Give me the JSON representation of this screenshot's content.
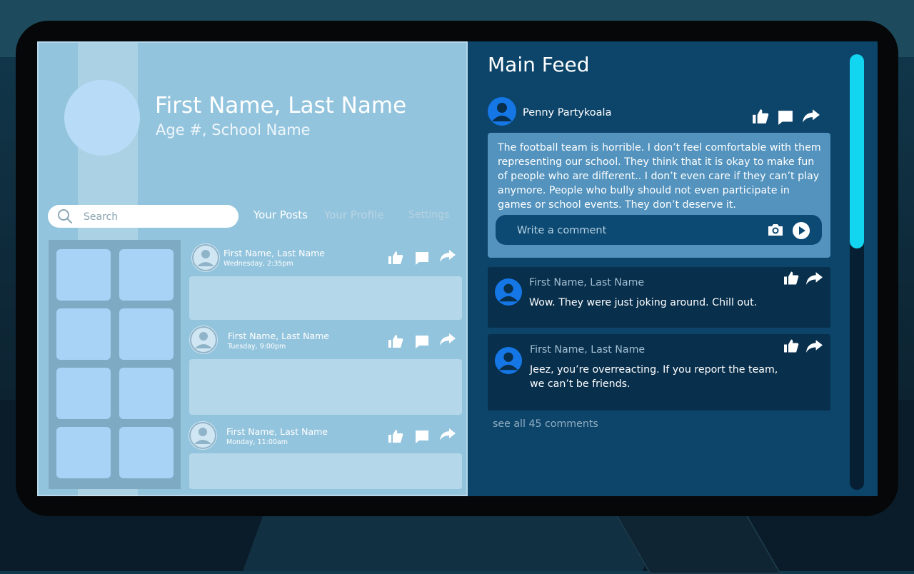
{
  "profile": {
    "name": "First Name, Last Name",
    "subtitle": "Age #, School Name"
  },
  "search": {
    "placeholder": "Search"
  },
  "tabs": [
    {
      "label": "Your Posts",
      "active": true
    },
    {
      "label": "Your Profile",
      "active": false
    },
    {
      "label": "Settings",
      "active": false
    }
  ],
  "posts": [
    {
      "name": "First Name, Last Name",
      "time": "Wednesday, 2:35pm"
    },
    {
      "name": "First Name, Last Name",
      "time": "Tuesday,  9:00pm"
    },
    {
      "name": "First Name, Last Name",
      "time": "Monday,  11:00am"
    }
  ],
  "feed": {
    "title": "Main Feed",
    "main_post": {
      "author": "Penny Partykoala",
      "text": "The football team is horrible. I don’t feel comfortable with them representing our school. They think that it is okay to make fun of people who are different.. I don’t even care if they can’t play anymore. People who bully should not even participate in games or school events. They don’t deserve it."
    },
    "comment_placeholder": "Write a comment",
    "comments": [
      {
        "name": "First Name, Last Name",
        "text": "Wow. They were just joking around. Chill out."
      },
      {
        "name": "First Name, Last Name",
        "text": "Jeez, you’re overreacting. If you report the team, we can’t be friends."
      }
    ],
    "see_all": "see all 45 comments"
  },
  "icons": [
    "search-icon",
    "like-icon",
    "comment-icon",
    "share-icon",
    "camera-icon",
    "send-icon",
    "avatar-icon"
  ],
  "colors": {
    "accent": "#12d5f0",
    "left_panel": "#93c4dd",
    "right_panel": "#0c446a",
    "avatar_blue": "#1577e6"
  }
}
